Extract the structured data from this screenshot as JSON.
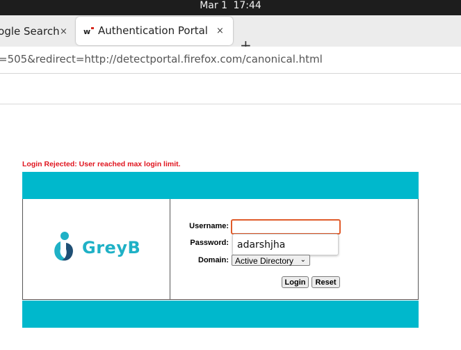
{
  "os": {
    "date": "Mar 1",
    "time": "17:44"
  },
  "tabs": [
    {
      "title": "oogle Search",
      "close": "×"
    },
    {
      "title": "Authentication Portal",
      "close": "×"
    }
  ],
  "new_tab": "+",
  "url": "=505&redirect=http://detectportal.firefox.com/canonical.html",
  "error_message": "Login Rejected: User reached max login limit.",
  "brand": {
    "name": "GreyB",
    "color": "#1fb1c6"
  },
  "form": {
    "username_label": "Username:",
    "username_value": "",
    "password_label": "Password:",
    "autocomplete_suggestion": "adarshjha",
    "domain_label": "Domain:",
    "domain_value": "Active Directory",
    "login_button": "Login",
    "reset_button": "Reset"
  },
  "colors": {
    "band": "#00b8cc",
    "error": "#e0141e",
    "focus": "#e05b2a"
  }
}
